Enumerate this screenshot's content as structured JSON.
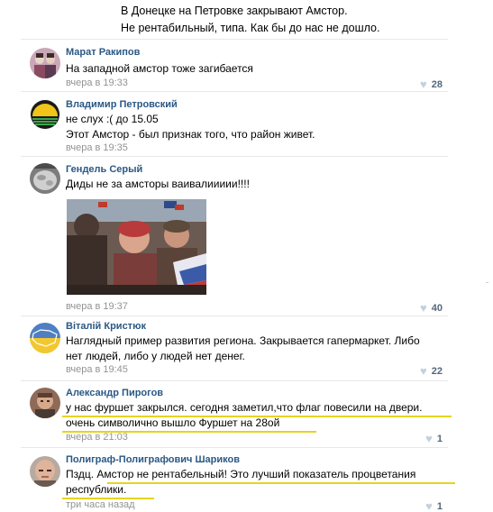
{
  "post": {
    "lines": [
      "В Донецке на Петровке закрывают Амстор.",
      "Не рентабильный, типа. Как бы до нас не дошло."
    ]
  },
  "comments": [
    {
      "author": "Марат Ракипов",
      "lines": [
        "На западной амстор тоже загибается"
      ],
      "time": "вчера в 19:33",
      "likes": "28",
      "avatar_icon": "avatar-two-people-icon"
    },
    {
      "author": "Владимир Петровский",
      "lines": [
        "не слух :( до 15.05",
        "Этот Амстор - был признак того, что район живет."
      ],
      "time": "вчера в 19:35",
      "likes": "",
      "avatar_icon": "avatar-sunrise-logo-icon"
    },
    {
      "author": "Гендель Серый",
      "lines": [
        "Диды не за амсторы ваивалиииии!!!!"
      ],
      "time": "вчера в 19:37",
      "likes": "40",
      "avatar_icon": "avatar-rock-icon",
      "photo_icon": "crowd-photo-icon"
    },
    {
      "author": "Віталій Кристюк",
      "lines": [
        "Наглядный пример развития региона. Закрывается гапермаркет. Либо",
        "нет людей, либо у людей нет денег."
      ],
      "time": "вчера в 19:45",
      "likes": "22",
      "avatar_icon": "avatar-ukraine-map-icon"
    },
    {
      "author": "Александр Пирогов",
      "lines": [
        "у нас фуршет закрылся. сегодня заметил,что флаг повесили на двери.",
        "очень символично вышло   Фуршет на 28ой"
      ],
      "time": "вчера в 21:03",
      "likes": "1",
      "avatar_icon": "avatar-man-icon"
    },
    {
      "author": "Полиграф-Полиграфович Шариков",
      "lines": [
        "Пздц. Амстор не рентабельный! Это лучший показатель процветания",
        "республики."
      ],
      "time": "три часа назад",
      "likes": "1",
      "avatar_icon": "avatar-bald-man-icon"
    }
  ],
  "colors": {
    "author_link": "#2a5885",
    "time": "#939393",
    "likes": "#55677d",
    "heart": "#c5d0db",
    "highlight_underline": "#e6d322",
    "divider": "#e7e8ec"
  },
  "icons": {
    "heart": "heart-icon"
  }
}
